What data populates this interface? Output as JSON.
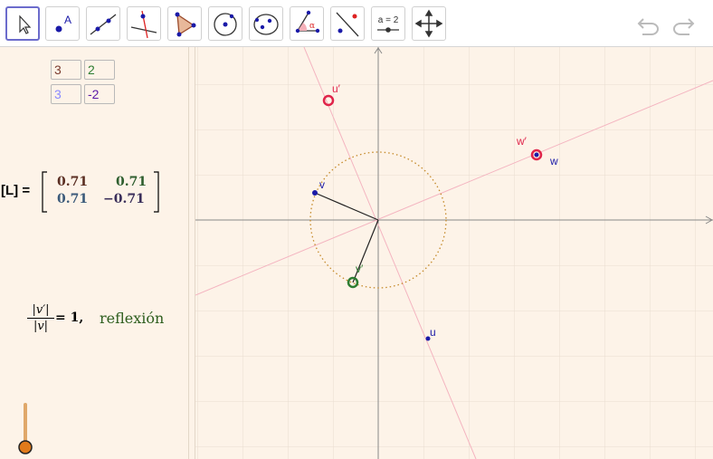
{
  "toolbar": {
    "tools": [
      {
        "name": "move-tool",
        "selected": true
      },
      {
        "name": "point-tool",
        "label": "A"
      },
      {
        "name": "line-tool"
      },
      {
        "name": "perpendicular-line-tool"
      },
      {
        "name": "polygon-tool"
      },
      {
        "name": "circle-center-point-tool"
      },
      {
        "name": "conic-five-points-tool"
      },
      {
        "name": "angle-tool",
        "label": "α"
      },
      {
        "name": "reflect-about-line-tool"
      },
      {
        "name": "slider-tool",
        "label": "a = 2"
      },
      {
        "name": "move-graphics-view-tool"
      }
    ]
  },
  "algebra": {
    "matrix_inputs": [
      [
        "3",
        "2"
      ],
      [
        "3",
        "-2"
      ]
    ],
    "matrix_label": "[L] =",
    "matrix": [
      [
        "0.71",
        "0.71"
      ],
      [
        "0.71",
        "−0.71"
      ]
    ],
    "ratio_num": "|v′|",
    "ratio_den": "|v|",
    "ratio_eq": "= 1,",
    "result": "reflexión"
  },
  "graphics": {
    "points": {
      "u": "u",
      "u_prime": "u′",
      "v": "v",
      "v_prime": "v′",
      "w": "w",
      "w_prime": "w′"
    }
  },
  "colors": {
    "background": "#fdf3e8",
    "point_blue": "#1a1aa8",
    "image_red": "#e0244a",
    "image_green": "#2e7d32",
    "circle": "#c58a2a",
    "slider": "#e07a1a"
  }
}
